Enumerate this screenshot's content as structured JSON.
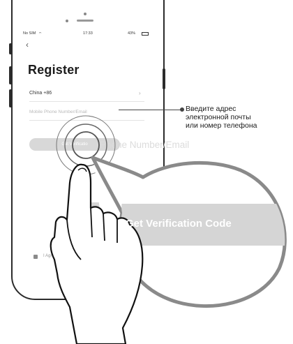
{
  "status": {
    "carrier": "No SIM",
    "time": "17:33",
    "battery": "43%"
  },
  "nav": {
    "back_icon": "‹"
  },
  "form": {
    "title": "Register",
    "country": "China +86",
    "phone_placeholder": "Mobile Phone Number/Email",
    "button_label": "Get Verificatio",
    "agree_text": "I Agr"
  },
  "callout": {
    "line1": "Введите адрес",
    "line2": "электронной почты",
    "line3": "или номер телефона"
  },
  "zoom": {
    "field_text": "Phone Number/Email",
    "button_label": "Get Verification Code"
  }
}
